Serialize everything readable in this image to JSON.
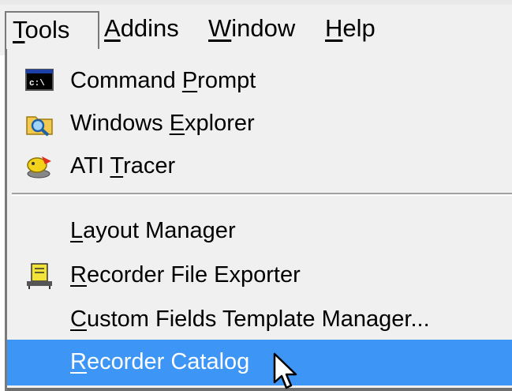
{
  "menubar": {
    "items": [
      {
        "pre": "",
        "key": "T",
        "post": "ools"
      },
      {
        "pre": "",
        "key": "A",
        "post": "ddins"
      },
      {
        "pre": "",
        "key": "W",
        "post": "indow"
      },
      {
        "pre": "",
        "key": "H",
        "post": "elp"
      }
    ],
    "open_menu": "Tools"
  },
  "tools_menu": {
    "items": [
      {
        "pre": "Command ",
        "key": "P",
        "post": "rompt",
        "icon": "command-prompt-icon"
      },
      {
        "pre": "Windows ",
        "key": "E",
        "post": "xplorer",
        "icon": "windows-explorer-icon"
      },
      {
        "pre": "ATI ",
        "key": "T",
        "post": "racer",
        "icon": "ati-tracer-icon"
      },
      {
        "pre": "",
        "key": "L",
        "post": "ayout Manager",
        "icon": ""
      },
      {
        "pre": "",
        "key": "R",
        "post": "ecorder File Exporter",
        "icon": "recorder-file-exporter-icon"
      },
      {
        "pre": "",
        "key": "C",
        "post": "ustom Fields Template Manager...",
        "icon": ""
      },
      {
        "pre": "",
        "key": "R",
        "post": "ecorder Catalog",
        "icon": "",
        "selected": true
      }
    ]
  },
  "colors": {
    "selection": "#3d96f5",
    "menu_bg": "#f0f0f0"
  }
}
